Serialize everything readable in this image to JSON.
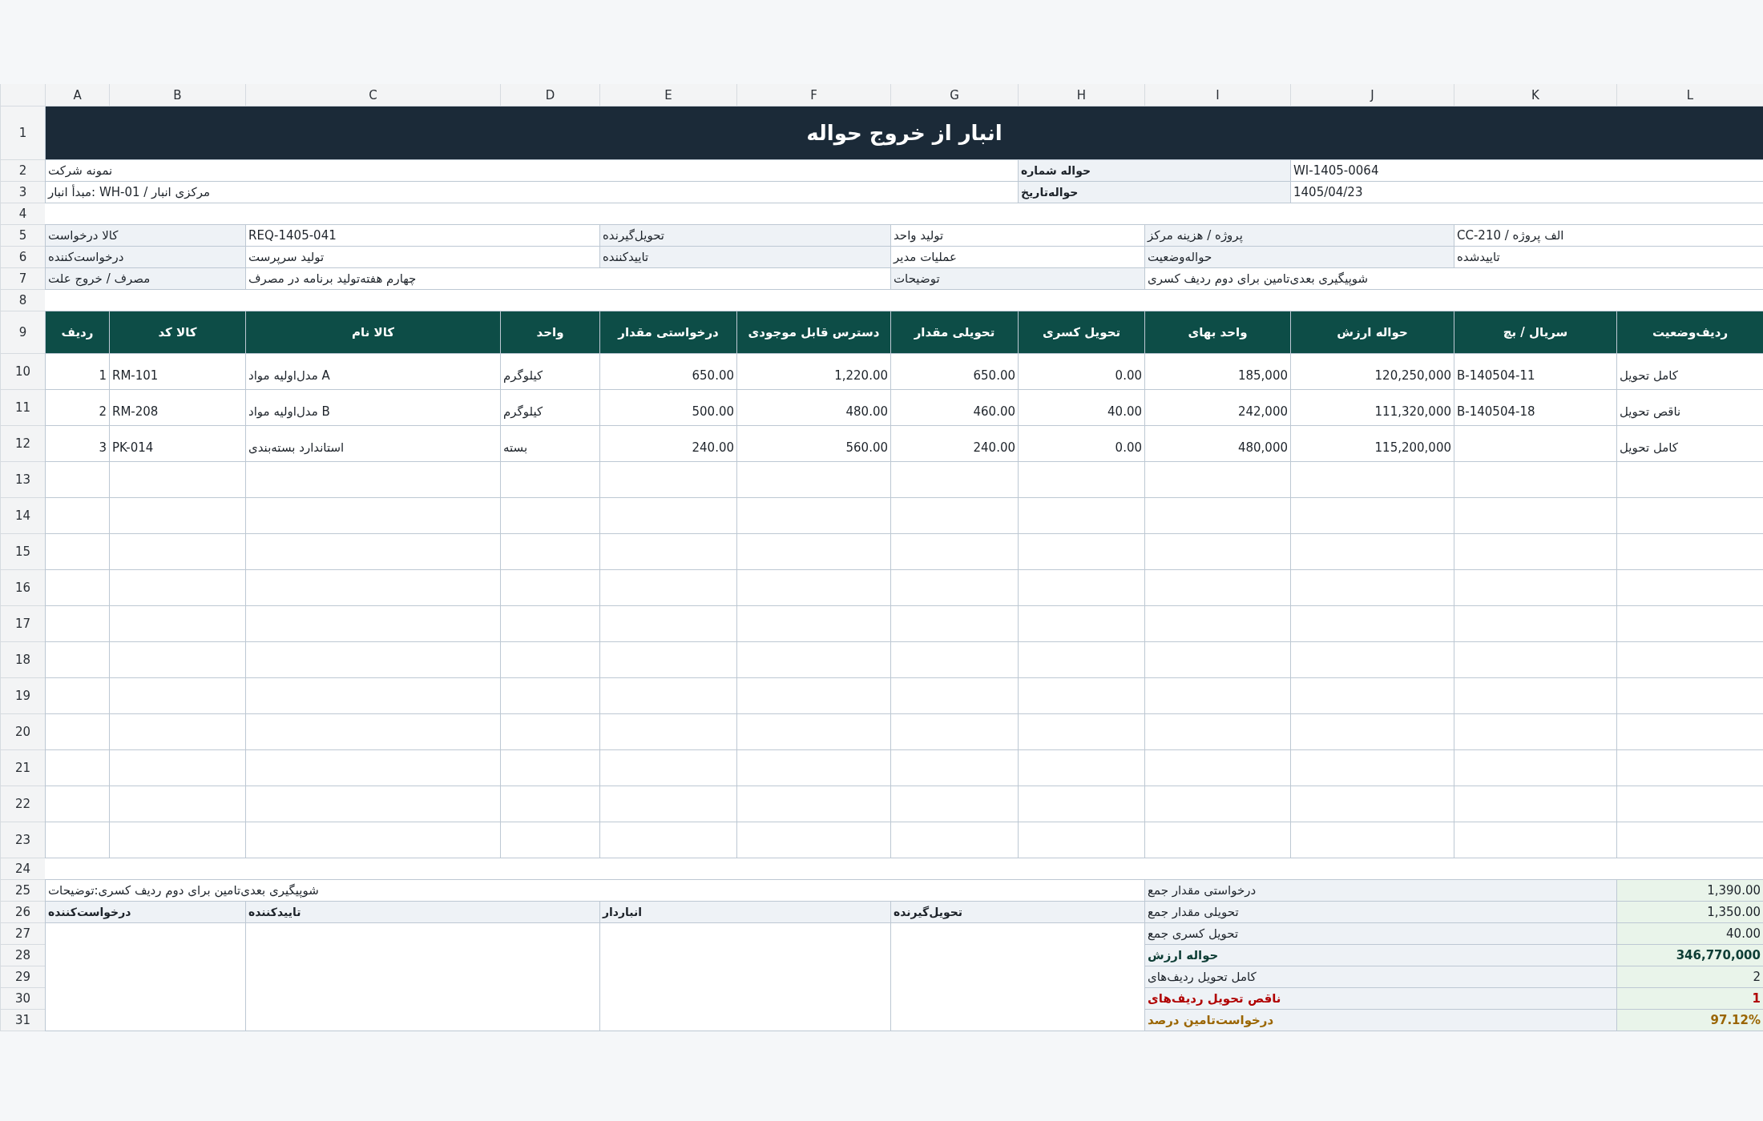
{
  "column_headers": [
    "L",
    "K",
    "J",
    "I",
    "H",
    "G",
    "F",
    "E",
    "D",
    "C",
    "B",
    "A"
  ],
  "row_numbers": [
    "1",
    "2",
    "3",
    "4",
    "5",
    "6",
    "7",
    "8",
    "9",
    "10",
    "11",
    "12",
    "13",
    "14",
    "15",
    "16",
    "17",
    "18",
    "19",
    "20",
    "21",
    "22",
    "23",
    "24",
    "25",
    "26",
    "27",
    "28",
    "29",
    "30",
    "31"
  ],
  "title": "انبار از خروج حواله",
  "doc_fields": [
    {
      "label": "حواله شماره",
      "value": "WI-1405-0064"
    },
    {
      "label": "حواله‌تاریخ",
      "value": "1405/04/23"
    }
  ],
  "company": "نمونه شرکت",
  "source_warehouse": "مرکزی انبار / WH-01 :مبدأ انبار",
  "info_rows": [
    [
      {
        "text": "الف پروژه / CC-210",
        "kind": "value"
      },
      {
        "text": "پروژه / هزینه مرکز",
        "kind": "label"
      },
      {
        "text": "تولید واحد",
        "kind": "value"
      },
      {
        "text": "تحویل‌گیرنده",
        "kind": "label"
      },
      {
        "text": "REQ-1405-041",
        "kind": "value"
      },
      {
        "text": "کالا درخواست",
        "kind": "label"
      }
    ],
    [
      {
        "text": "تاییدشده",
        "kind": "value"
      },
      {
        "text": "حواله‌وضعیت",
        "kind": "label"
      },
      {
        "text": "عملیات مدیر",
        "kind": "value"
      },
      {
        "text": "تاییدکننده",
        "kind": "label"
      },
      {
        "text": "تولید سرپرست",
        "kind": "value"
      },
      {
        "text": "درخواست‌کننده",
        "kind": "label"
      }
    ]
  ],
  "notes": {
    "label": "توضیحات",
    "value": "شوپیگیری بعدی‌تامین برای دوم ردیف کسری"
  },
  "reason": {
    "label": "مصرف / خروج علت",
    "value": "چهارم هفته‌تولید برنامه در مصرف"
  },
  "table": {
    "columns": [
      "ردیف‌وضعیت",
      "سریال / بچ",
      "حواله ارزش",
      "واحد بهای",
      "تحویل کسری",
      "تحویلی مقدار",
      "دسترس قابل موجودی",
      "درخواستی مقدار",
      "واحد",
      "کالا نام",
      "کالا کد",
      "ردیف"
    ],
    "rows": [
      [
        "کامل تحویل",
        "B-140504-11",
        "120,250,000",
        "185,000",
        "0.00",
        "650.00",
        "1,220.00",
        "650.00",
        "کیلوگرم",
        "A مدل‌اولیه مواد",
        "RM-101",
        "1"
      ],
      [
        "ناقص تحویل",
        "B-140504-18",
        "111,320,000",
        "242,000",
        "40.00",
        "460.00",
        "480.00",
        "500.00",
        "کیلوگرم",
        "B مدل‌اولیه مواد",
        "RM-208",
        "2"
      ],
      [
        "کامل تحویل",
        null,
        "115,200,000",
        "480,000",
        "0.00",
        "240.00",
        "560.00",
        "240.00",
        "بسته",
        "استاندارد بسته‌بندی",
        "PK-014",
        "3"
      ]
    ]
  },
  "totals": [
    {
      "label": "درخواستی مقدار جمع",
      "value": "1,390.00",
      "kind": "normal"
    },
    {
      "label": "تحویلی مقدار جمع",
      "value": "1,350.00",
      "kind": "normal"
    },
    {
      "label": "تحویل کسری جمع",
      "value": "40.00",
      "kind": "normal"
    },
    {
      "label": "حواله ارزش",
      "value": "346,770,000",
      "kind": "strong"
    },
    {
      "label": "کامل تحویل ردیف‌های",
      "value": "2",
      "kind": "normal"
    },
    {
      "label": "ناقص تحویل ردیف‌های",
      "value": "1",
      "kind": "alert"
    },
    {
      "label": "درخواست‌تامین درصد",
      "value": "97.12%",
      "kind": "warn"
    }
  ],
  "footer_note": "شوپیگیری بعدی‌تامین برای دوم ردیف کسری:توضیحات",
  "signatures": [
    "تحویل‌گیرنده",
    "انباردار",
    "تاییدکننده",
    "درخواست‌کننده"
  ]
}
